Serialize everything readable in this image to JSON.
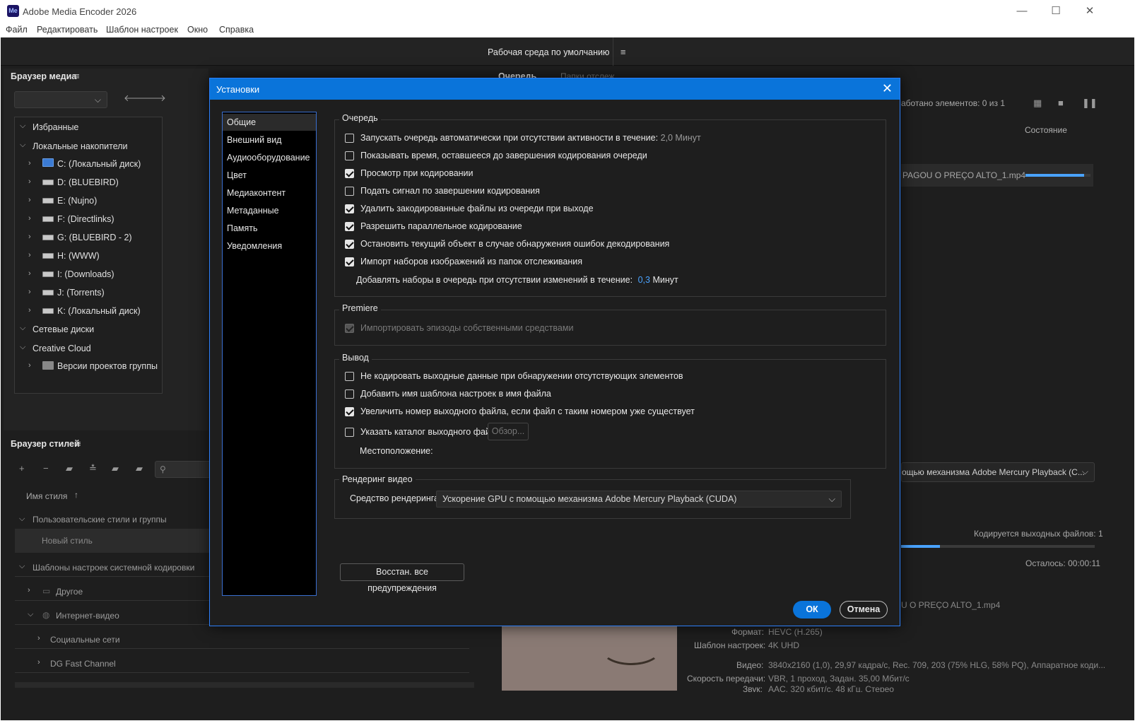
{
  "window": {
    "title": "Adobe Media Encoder 2026",
    "app_logo": "Me"
  },
  "menu": [
    "Файл",
    "Редактировать",
    "Шаблон настроек",
    "Окно",
    "Справка"
  ],
  "workspace": {
    "label": "Рабочая среда по умолчанию"
  },
  "media_browser": {
    "title": "Браузер медиа",
    "tree": {
      "favorites": "Избранные",
      "local_drives": "Локальные накопители",
      "drives": [
        "C: (Локальный диск)",
        "D: (BLUEBIRD)",
        "E: (Nujno)",
        "F: (Directlinks)",
        "G: (BLUEBIRD - 2)",
        "H: (WWW)",
        "I: (Downloads)",
        "J: (Torrents)",
        "K: (Локальный диск)"
      ],
      "network": "Сетевые диски",
      "creative_cloud": "Creative Cloud",
      "team_projects": "Версии проектов группы"
    }
  },
  "style_browser": {
    "title": "Браузер стилей",
    "column": "Имя стиля",
    "user_group": "Пользовательские стили и группы",
    "new_style": "Новый стиль",
    "system_group": "Шаблоны настроек системной кодировки",
    "other": "Другое",
    "internet_video": "Интернет-видео",
    "social": "Социальные сети",
    "dg": "DG Fast Channel"
  },
  "queue": {
    "tab_queue": "Очередь",
    "tab_watch": "Папки отслеж...",
    "processed": "аботано элементов: 0 из 1",
    "status_col": "Состояние",
    "file": "PAGOU O PREÇO ALTO_1.mp4",
    "file_progress": 0.9,
    "renderer": "ощью механизма Adobe Mercury Playback (C...",
    "encoding_files": "Кодируется выходных файлов: 1",
    "encoding_progress": 0.2,
    "remaining": "Осталось: 00:00:11",
    "output_file": "U O PREÇO ALTO_1.mp4",
    "meta": {
      "format_k": "Формат:",
      "format_v": "HEVC (H.265)",
      "preset_k": "Шаблон настроек:",
      "preset_v": "4K UHD",
      "video_k": "Видео:",
      "video_v": "3840x2160 (1,0), 29,97 кадра/с, Rec. 709, 203 (75% HLG, 58% PQ), Аппаратное коди...",
      "bitrate_k": "Скорость передачи:",
      "bitrate_v": "VBR, 1 проход, Задан. 35,00 Мбит/с",
      "audio_k": "Звук:",
      "audio_v": "AAC, 320 кбит/с, 48 кГц, Стерео"
    }
  },
  "dialog": {
    "title": "Установки",
    "nav": [
      "Общие",
      "Внешний вид",
      "Аудиооборудование",
      "Цвет",
      "Медиаконтент",
      "Метаданные",
      "Память",
      "Уведомления"
    ],
    "nav_selected": 0,
    "queue_group": {
      "label": "Очередь",
      "options": [
        {
          "label": "Запускать очередь автоматически при отсутствии активности в течение:",
          "checked": false,
          "suffix": "2,0 Минут"
        },
        {
          "label": "Показывать время, оставшееся до завершения кодирования очереди",
          "checked": false
        },
        {
          "label": "Просмотр при кодировании",
          "checked": true
        },
        {
          "label": "Подать сигнал по завершении кодирования",
          "checked": false
        },
        {
          "label": "Удалить закодированные файлы из очереди при выходе",
          "checked": true
        },
        {
          "label": "Разрешить параллельное кодирование",
          "checked": true
        },
        {
          "label": "Остановить текущий объект в случае обнаружения ошибок декодирования",
          "checked": true
        },
        {
          "label": "Импорт наборов изображений из папок отслеживания",
          "checked": true
        }
      ],
      "add_sets_label": "Добавлять наборы в очередь при отсутствии изменений в течение:",
      "add_sets_value": "0,3",
      "add_sets_unit": "Минут"
    },
    "premiere_group": {
      "label": "Premiere",
      "option": "Импортировать эпизоды собственными средствами"
    },
    "output_group": {
      "label": "Вывод",
      "options": [
        {
          "label": "Не кодировать выходные данные при обнаружении отсутствующих элементов",
          "checked": false
        },
        {
          "label": "Добавить имя шаблона настроек в имя файла",
          "checked": false
        },
        {
          "label": "Увеличить номер выходного файла, если файл с таким номером уже существует",
          "checked": true
        },
        {
          "label": "Указать каталог выходного файла:",
          "checked": false
        }
      ],
      "browse": "Обзор...",
      "location": "Местоположение:"
    },
    "render_group": {
      "label": "Рендеринг видео",
      "renderer_label": "Средство рендеринга:",
      "renderer_value": "Ускорение GPU с помощью механизма Adobe Mercury Playback (CUDA)"
    },
    "reset_warnings": "Восстан. все предупреждения",
    "ok": "ОК",
    "cancel": "Отмена"
  }
}
